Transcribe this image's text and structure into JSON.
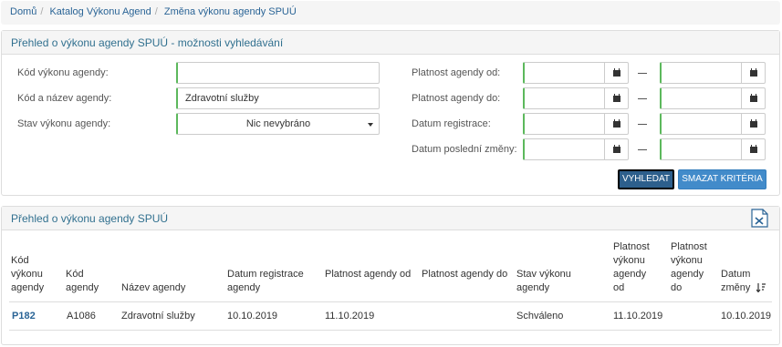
{
  "breadcrumb": {
    "items": [
      "Domů",
      "Katalog Výkonu Agend",
      "Změna výkonu agendy SPUÚ"
    ]
  },
  "search": {
    "title": "Přehled o výkonu agendy SPUÚ - možnosti vyhledávání",
    "kod_label": "Kód výkonu agendy:",
    "kod_value": "",
    "nazev_label": "Kód a název agendy:",
    "nazev_value": "Zdravotní služby",
    "stav_label": "Stav výkonu agendy:",
    "stav_value": "Nic nevybráno",
    "platnost_od_label": "Platnost agendy od:",
    "platnost_do_label": "Platnost agendy do:",
    "registrace_label": "Datum registrace:",
    "zmena_label": "Datum poslední změny:",
    "search_button": "VYHLEDAT",
    "clear_button": "SMAZAT KRITÉRIA"
  },
  "results": {
    "title": "Přehled o výkonu agendy SPUÚ",
    "export_icon": "excel-export-icon",
    "columns": [
      "Kód výkonu agendy",
      "Kód agendy",
      "Název agendy",
      "Datum registrace agendy",
      "Platnost agendy od",
      "Platnost agendy do",
      "Stav výkonu agendy",
      "Platnost výkonu agendy od",
      "Platnost výkonu agendy do",
      "Datum změny"
    ],
    "rows": [
      [
        "P182",
        "A1086",
        "Zdravotní služby",
        "10.10.2019",
        "11.10.2019",
        "",
        "Schváleno",
        "11.10.2019",
        "",
        "10.10.2019"
      ]
    ]
  },
  "colors": {
    "accent": "#428bca",
    "heading_text": "#31708f",
    "valid_border": "#5cb85c"
  }
}
